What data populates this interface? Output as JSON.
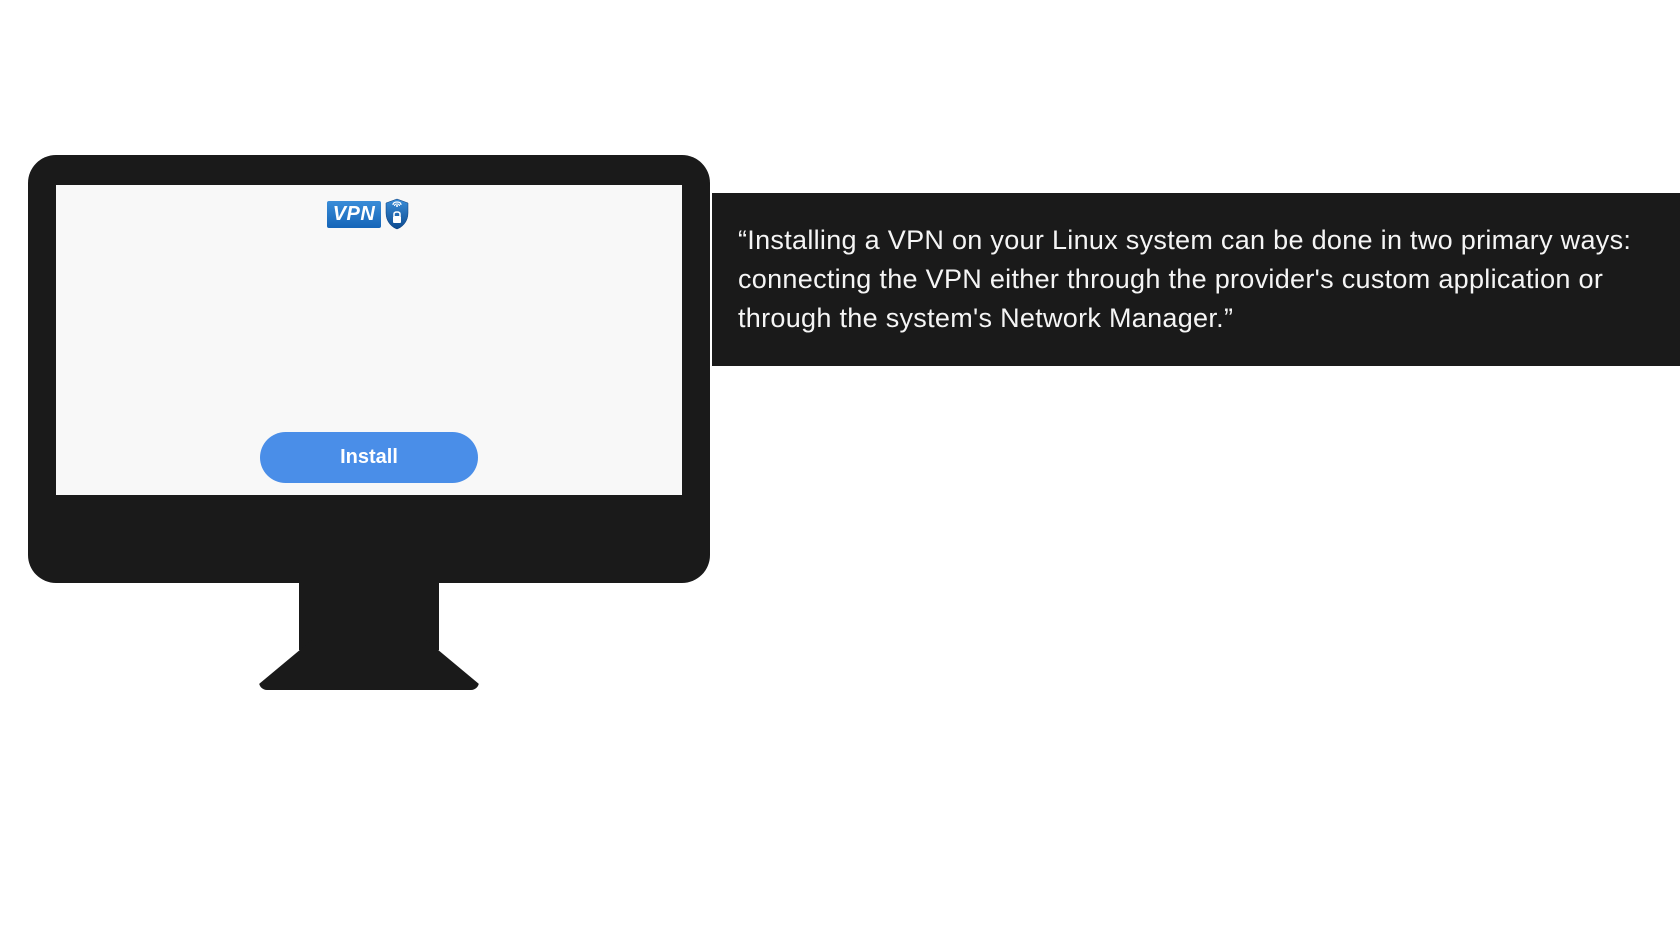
{
  "screen": {
    "logo_text": "VPN",
    "install_button_label": "Install"
  },
  "quote": {
    "text": "“Installing a VPN on your Linux system can be done in two primary ways: connecting the VPN either through the provider's custom application or through the system's Network Manager.”"
  }
}
